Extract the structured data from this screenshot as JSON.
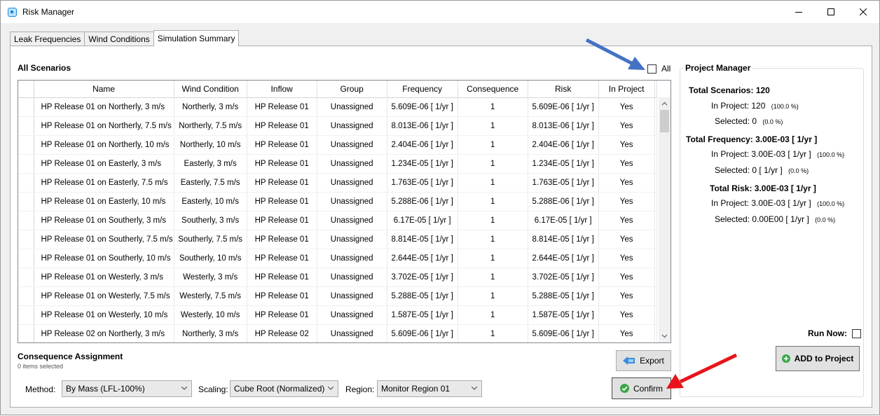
{
  "window": {
    "title": "Risk Manager"
  },
  "tabs": [
    {
      "label": "Leak Frequencies"
    },
    {
      "label": "Wind Conditions"
    },
    {
      "label": "Simulation Summary",
      "active": true
    }
  ],
  "scenarios": {
    "title": "All Scenarios",
    "all_label": "All",
    "all_checked": false,
    "columns": [
      "Name",
      "Wind Condition",
      "Inflow",
      "Group",
      "Frequency",
      "Consequence",
      "Risk",
      "In Project"
    ],
    "rows": [
      [
        "HP Release 01 on Northerly, 3 m/s",
        "Northerly, 3 m/s",
        "HP Release 01",
        "Unassigned",
        "5.609E-06 [ 1/yr ]",
        "1",
        "5.609E-06 [ 1/yr ]",
        "Yes"
      ],
      [
        "HP Release 01 on Northerly, 7.5 m/s",
        "Northerly, 7.5 m/s",
        "HP Release 01",
        "Unassigned",
        "8.013E-06 [ 1/yr ]",
        "1",
        "8.013E-06 [ 1/yr ]",
        "Yes"
      ],
      [
        "HP Release 01 on Northerly, 10 m/s",
        "Northerly, 10 m/s",
        "HP Release 01",
        "Unassigned",
        "2.404E-06 [ 1/yr ]",
        "1",
        "2.404E-06 [ 1/yr ]",
        "Yes"
      ],
      [
        "HP Release 01 on Easterly, 3 m/s",
        "Easterly, 3 m/s",
        "HP Release 01",
        "Unassigned",
        "1.234E-05 [ 1/yr ]",
        "1",
        "1.234E-05 [ 1/yr ]",
        "Yes"
      ],
      [
        "HP Release 01 on Easterly, 7.5 m/s",
        "Easterly, 7.5 m/s",
        "HP Release 01",
        "Unassigned",
        "1.763E-05 [ 1/yr ]",
        "1",
        "1.763E-05 [ 1/yr ]",
        "Yes"
      ],
      [
        "HP Release 01 on Easterly, 10 m/s",
        "Easterly, 10 m/s",
        "HP Release 01",
        "Unassigned",
        "5.288E-06 [ 1/yr ]",
        "1",
        "5.288E-06 [ 1/yr ]",
        "Yes"
      ],
      [
        "HP Release 01 on Southerly, 3 m/s",
        "Southerly, 3 m/s",
        "HP Release 01",
        "Unassigned",
        "6.17E-05 [ 1/yr ]",
        "1",
        "6.17E-05 [ 1/yr ]",
        "Yes"
      ],
      [
        "HP Release 01 on Southerly, 7.5 m/s",
        "Southerly, 7.5 m/s",
        "HP Release 01",
        "Unassigned",
        "8.814E-05 [ 1/yr ]",
        "1",
        "8.814E-05 [ 1/yr ]",
        "Yes"
      ],
      [
        "HP Release 01 on Southerly, 10 m/s",
        "Southerly, 10 m/s",
        "HP Release 01",
        "Unassigned",
        "2.644E-05 [ 1/yr ]",
        "1",
        "2.644E-05 [ 1/yr ]",
        "Yes"
      ],
      [
        "HP Release 01 on Westerly, 3 m/s",
        "Westerly, 3 m/s",
        "HP Release 01",
        "Unassigned",
        "3.702E-05 [ 1/yr ]",
        "1",
        "3.702E-05 [ 1/yr ]",
        "Yes"
      ],
      [
        "HP Release 01 on Westerly, 7.5 m/s",
        "Westerly, 7.5 m/s",
        "HP Release 01",
        "Unassigned",
        "5.288E-05 [ 1/yr ]",
        "1",
        "5.288E-05 [ 1/yr ]",
        "Yes"
      ],
      [
        "HP Release 01 on Westerly, 10 m/s",
        "Westerly, 10 m/s",
        "HP Release 01",
        "Unassigned",
        "1.587E-05 [ 1/yr ]",
        "1",
        "1.587E-05 [ 1/yr ]",
        "Yes"
      ],
      [
        "HP Release 02 on Northerly, 3 m/s",
        "Northerly, 3 m/s",
        "HP Release 02",
        "Unassigned",
        "5.609E-06 [ 1/yr ]",
        "1",
        "5.609E-06 [ 1/yr ]",
        "Yes"
      ]
    ]
  },
  "consequence": {
    "title": "Consequence Assignment",
    "selected_count": "0 items selected",
    "method_label": "Method:",
    "method_value": "By Mass (LFL-100%)",
    "scaling_label": "Scaling:",
    "scaling_value": "Cube Root (Normalized)",
    "region_label": "Region:",
    "region_value": "Monitor Region 01",
    "export_label": "Export",
    "confirm_label": "Confirm"
  },
  "project_manager": {
    "title": "Project Manager",
    "total_scenarios_label": "Total Scenarios:",
    "total_scenarios_value": "120",
    "scen_in_project_label": "In Project:",
    "scen_in_project_value": "120",
    "scen_in_project_pct": "(100.0 %)",
    "scen_selected_label": "Selected:",
    "scen_selected_value": "0",
    "scen_selected_pct": "(0.0 %)",
    "total_frequency_label": "Total Frequency:",
    "total_frequency_value": "3.00E-03 [ 1/yr ]",
    "freq_in_project_label": "In Project:",
    "freq_in_project_value": "3.00E-03 [ 1/yr ]",
    "freq_in_project_pct": "(100.0 %)",
    "freq_selected_label": "Selected:",
    "freq_selected_value": "0 [ 1/yr ]",
    "freq_selected_pct": "(0.0 %)",
    "total_risk_label": "Total Risk:",
    "total_risk_value": "3.00E-03 [ 1/yr ]",
    "risk_in_project_label": "In Project:",
    "risk_in_project_value": "3.00E-03 [ 1/yr ]",
    "risk_in_project_pct": "(100.0 %)",
    "risk_selected_label": "Selected:",
    "risk_selected_value": "0.00E00 [ 1/yr ]",
    "risk_selected_pct": "(0.0 %)",
    "run_now_label": "Run Now:",
    "run_now_checked": false,
    "add_label": "ADD to Project"
  },
  "annotation_colors": {
    "blue_arrow": "#4472c4",
    "red_arrow": "#e8141a"
  }
}
